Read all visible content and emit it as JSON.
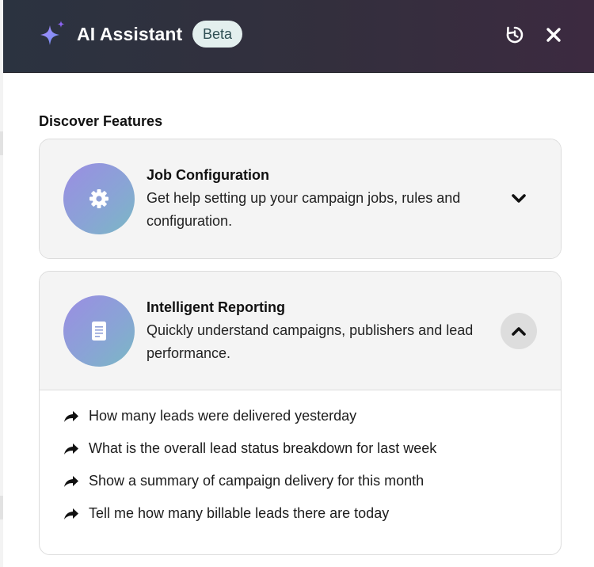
{
  "header": {
    "title": "AI Assistant",
    "badge": "Beta",
    "icons": {
      "logo": "sparkle-icon",
      "history": "history-icon",
      "close": "close-icon"
    },
    "colors": {
      "gradient_start": "#2b3340",
      "gradient_end": "#3c2a40",
      "badge_bg": "#e3efee"
    }
  },
  "main": {
    "section_title": "Discover Features",
    "features": [
      {
        "title": "Job Configuration",
        "description": "Get help setting up your campaign jobs, rules and configuration.",
        "icon": "gear-icon",
        "expanded": false
      },
      {
        "title": "Intelligent Reporting",
        "description": "Quickly understand campaigns, publishers and lead performance.",
        "icon": "document-icon",
        "expanded": true,
        "prompts": [
          "How many leads were delivered yesterday",
          "What is the overall lead status breakdown for last week",
          "Show a summary of campaign delivery for this month",
          "Tell me how many billable leads there are today"
        ]
      }
    ]
  }
}
